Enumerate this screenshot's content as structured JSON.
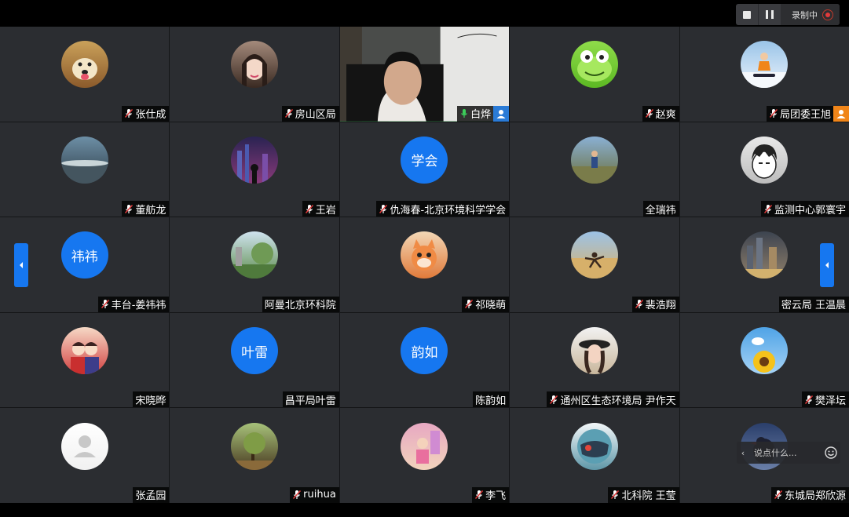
{
  "recording": {
    "status": "录制中"
  },
  "chat": {
    "placeholder": "说点什么..."
  },
  "participants": [
    {
      "name": "张仕成",
      "avatar": "dog-photo"
    },
    {
      "name": "房山区局",
      "avatar": "woman-photo"
    },
    {
      "name": "白烨",
      "avatar": "camera-video",
      "badge": "user-icon",
      "badge_color": "#2a7bd7",
      "mic_active": true
    },
    {
      "name": "赵爽",
      "avatar": "frog-cartoon"
    },
    {
      "name": "局团委王旭",
      "avatar": "snowboarder-photo",
      "badge": "host-icon",
      "badge_color": "#f08519"
    },
    {
      "name": "董舫龙",
      "avatar": "sky-photo"
    },
    {
      "name": "王岩",
      "avatar": "city-night-photo"
    },
    {
      "name": "仇海春-北京环境科学学会",
      "avatar_text": "学会"
    },
    {
      "name": "全瑞祎",
      "avatar": "hiker-photo",
      "muted_icon": false
    },
    {
      "name": "监测中心郭寰宇",
      "avatar": "manga-photo"
    },
    {
      "name": "丰台-姜祎祎",
      "avatar_text": "祎祎"
    },
    {
      "name": "阿曼北京环科院",
      "avatar": "trees-photo",
      "muted_icon": false
    },
    {
      "name": "祁晓萌",
      "avatar": "toy-fox-photo"
    },
    {
      "name": "裴浩翔",
      "avatar": "desert-photo"
    },
    {
      "name": "密云局 王温晨",
      "avatar": "city-photo",
      "muted_icon": false
    },
    {
      "name": "宋晓晔",
      "avatar": "couple-cartoon",
      "muted_icon": false
    },
    {
      "name": "昌平局叶雷",
      "avatar_text": "叶雷",
      "muted_icon": false
    },
    {
      "name": "陈韵如",
      "avatar_text": "韵如",
      "muted_icon": false
    },
    {
      "name": "通州区生态环境局 尹作天",
      "avatar": "girl-hat-photo"
    },
    {
      "name": "樊泽坛",
      "avatar": "sunflower-photo"
    },
    {
      "name": "张孟园",
      "avatar": "default-user",
      "muted_icon": false
    },
    {
      "name": "ruihua",
      "avatar": "forest-photo"
    },
    {
      "name": "李飞",
      "avatar": "child-photo"
    },
    {
      "name": "北科院 王莹",
      "avatar": "masked-cartoon"
    },
    {
      "name": "东城局郑欣源",
      "avatar": "bird-photo"
    }
  ],
  "colors": {
    "accent": "#1677f0",
    "tile": "#2b2d31",
    "active_speaker": "#2fa84f",
    "recording_dot": "#e23b3b"
  }
}
